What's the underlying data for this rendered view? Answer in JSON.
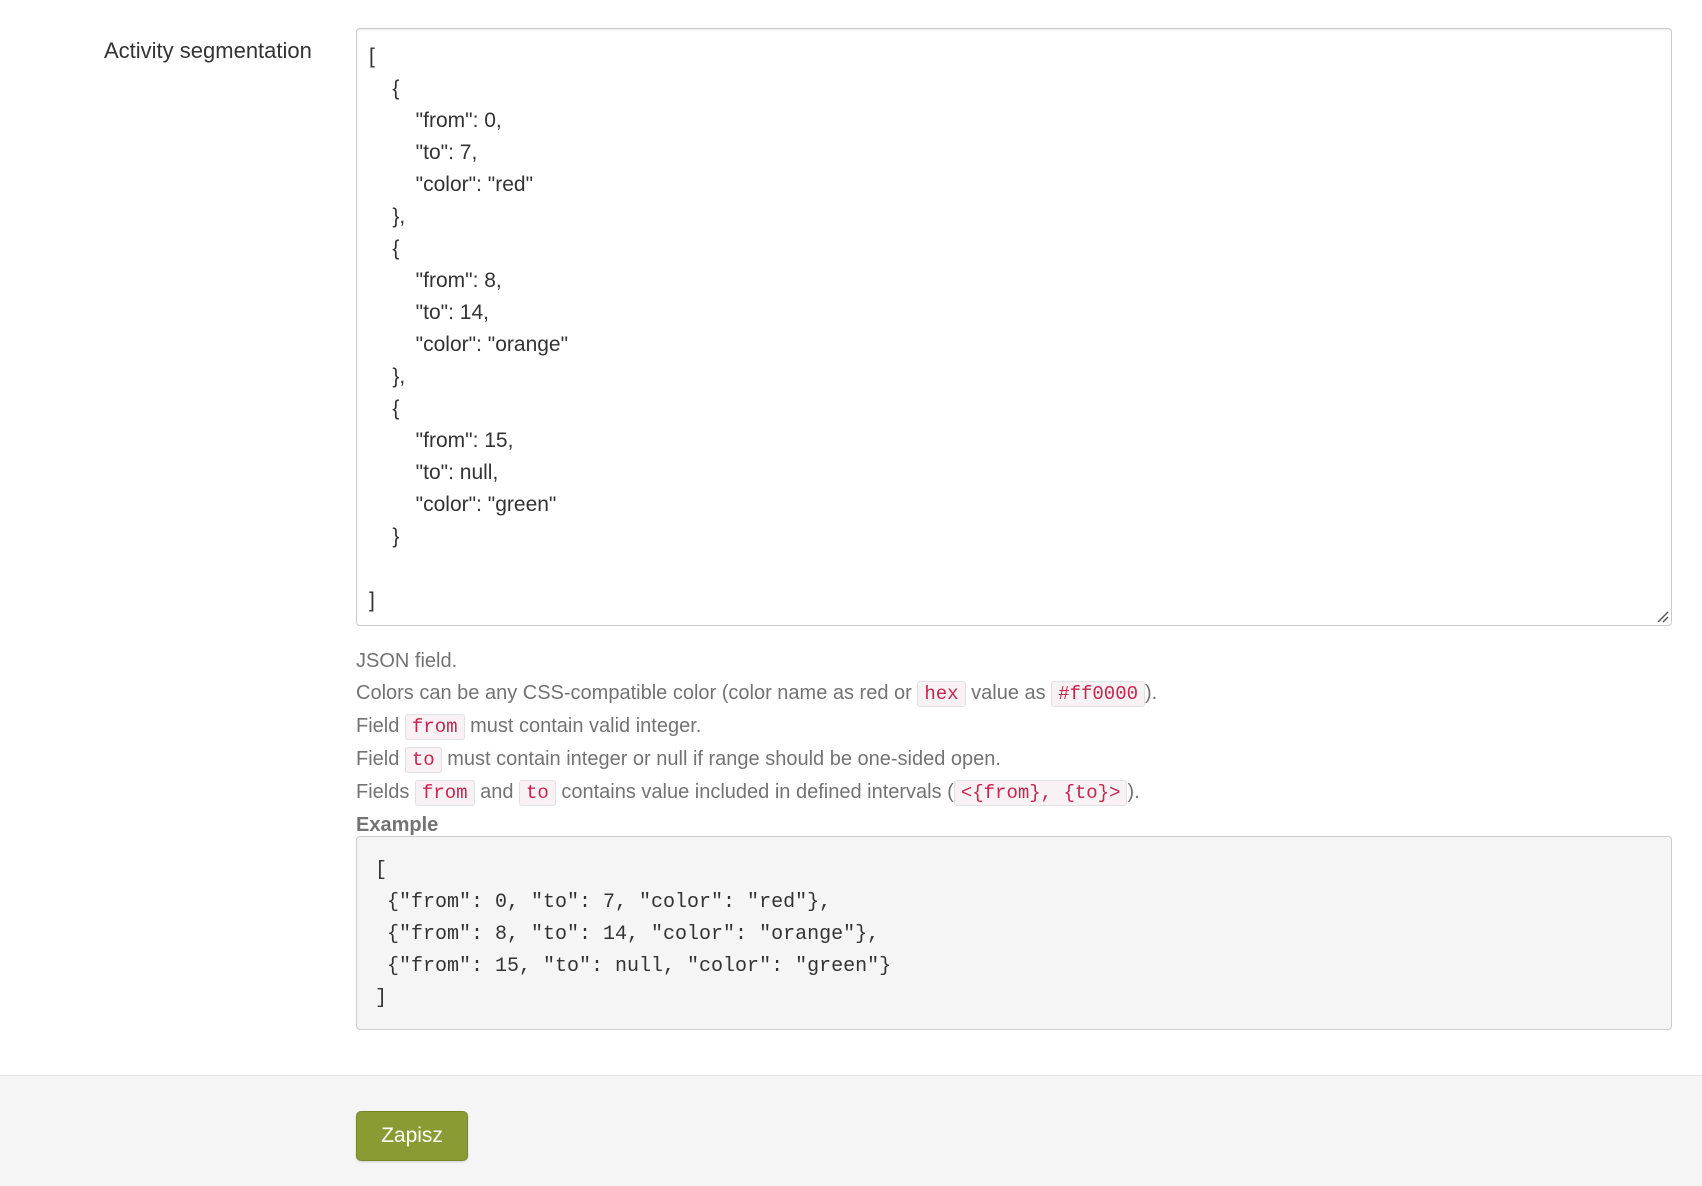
{
  "field": {
    "label": "Activity segmentation",
    "value": "[\n    {\n        \"from\": 0,\n        \"to\": 7,\n        \"color\": \"red\"\n    },\n    {\n        \"from\": 8,\n        \"to\": 14,\n        \"color\": \"orange\"\n    },\n    {\n        \"from\": 15,\n        \"to\": null,\n        \"color\": \"green\"\n    }\n\n]"
  },
  "help": {
    "line1": "JSON field.",
    "line2": {
      "text_a": "Colors can be any CSS-compatible color (color name as red or ",
      "code_a": "hex",
      "text_b": " value as ",
      "code_b": "#ff0000",
      "text_c": ")."
    },
    "line3": {
      "text_a": "Field ",
      "code_a": "from",
      "text_b": " must contain valid integer."
    },
    "line4": {
      "text_a": "Field ",
      "code_a": "to",
      "text_b": " must contain integer or null if range should be one-sided open."
    },
    "line5": {
      "text_a": "Fields ",
      "code_a": "from",
      "text_b": " and ",
      "code_b": "to",
      "text_c": " contains value included in defined intervals (",
      "code_c": "<{from}, {to}>",
      "text_d": ")."
    },
    "example_title": "Example",
    "example_code": "[\n {\"from\": 0, \"to\": 7, \"color\": \"red\"},\n {\"from\": 8, \"to\": 14, \"color\": \"orange\"},\n {\"from\": 15, \"to\": null, \"color\": \"green\"}\n]"
  },
  "actions": {
    "save_label": "Zapisz"
  },
  "colors": {
    "save_button": "#8a9b34",
    "code_text": "#c7254e",
    "help_text": "#737373"
  },
  "icons": {
    "resize": "resize-handle-icon"
  }
}
